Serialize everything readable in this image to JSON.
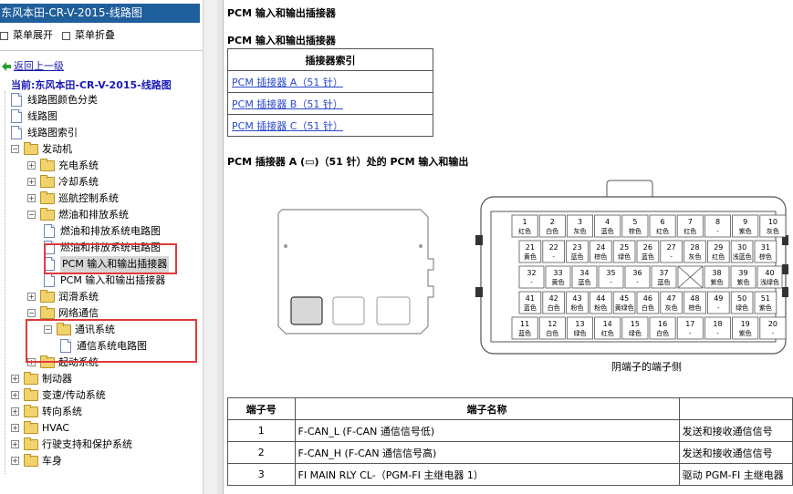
{
  "app": {
    "title": "东风本田-CR-V-2015-线路图"
  },
  "menu": {
    "expand": "菜单展开",
    "collapse": "菜单折叠"
  },
  "nav": {
    "back": "返回上一级",
    "current": "当前:东风本田-CR-V-2015-线路图"
  },
  "tree": [
    {
      "id": "color-class",
      "depth": 0,
      "type": "page",
      "label": "线路图颜色分类"
    },
    {
      "id": "wiring",
      "depth": 0,
      "type": "page",
      "label": "线路图"
    },
    {
      "id": "wiring-index",
      "depth": 0,
      "type": "page",
      "label": "线路图索引"
    },
    {
      "id": "engine",
      "depth": 0,
      "type": "folder",
      "toggle": "−",
      "label": "发动机"
    },
    {
      "id": "charging",
      "depth": 1,
      "type": "folder",
      "toggle": "+",
      "label": "充电系统"
    },
    {
      "id": "cooling",
      "depth": 1,
      "type": "folder",
      "toggle": "+",
      "label": "冷却系统"
    },
    {
      "id": "cruise",
      "depth": 1,
      "type": "folder",
      "toggle": "+",
      "label": "巡航控制系统"
    },
    {
      "id": "fuel",
      "depth": 1,
      "type": "folder",
      "toggle": "−",
      "label": "燃油和排放系统"
    },
    {
      "id": "fuel-circuit-1",
      "depth": 2,
      "type": "page",
      "label": "燃油和排放系统电路图"
    },
    {
      "id": "fuel-circuit-2",
      "depth": 2,
      "type": "page",
      "label": "燃油和排放系统电路图"
    },
    {
      "id": "pcm-io-selected",
      "depth": 2,
      "type": "page",
      "label": "PCM 输入和输出插接器",
      "selected": true
    },
    {
      "id": "pcm-io",
      "depth": 2,
      "type": "page",
      "label": "PCM 输入和输出插接器"
    },
    {
      "id": "lube",
      "depth": 1,
      "type": "folder",
      "toggle": "+",
      "label": "润滑系统"
    },
    {
      "id": "network",
      "depth": 1,
      "type": "folder",
      "toggle": "−",
      "label": "网络通信"
    },
    {
      "id": "comm",
      "depth": 2,
      "type": "folder",
      "toggle": "−",
      "label": "通讯系统"
    },
    {
      "id": "comm-circuit",
      "depth": 3,
      "type": "page",
      "label": "通信系统电路图"
    },
    {
      "id": "start",
      "depth": 1,
      "type": "folder",
      "toggle": "+",
      "label": "起动系统"
    },
    {
      "id": "brake",
      "depth": 0,
      "type": "folder",
      "toggle": "+",
      "label": "制动器"
    },
    {
      "id": "transmission",
      "depth": 0,
      "type": "folder",
      "toggle": "+",
      "label": "变速/传动系统"
    },
    {
      "id": "steering",
      "depth": 0,
      "type": "folder",
      "toggle": "+",
      "label": "转向系统"
    },
    {
      "id": "hvac",
      "depth": 0,
      "type": "folder",
      "toggle": "+",
      "label": "HVAC"
    },
    {
      "id": "driving-support",
      "depth": 0,
      "type": "folder",
      "toggle": "+",
      "label": "行驶支持和保护系统"
    },
    {
      "id": "body",
      "depth": 0,
      "type": "folder",
      "toggle": "+",
      "label": "车身"
    }
  ],
  "content": {
    "page_heading": "PCM 输入和输出插接器",
    "section_heading": "PCM 输入和输出插接器",
    "connector_index": {
      "header": "插接器索引",
      "links": [
        "PCM 插接器 A（51 针）",
        "PCM 插接器 B（51 针）",
        "PCM 插接器 C（51 针）"
      ]
    },
    "connector_a_heading": "PCM 插接器 A (▭)（51 针）处的 PCM 输入和输出",
    "diagram_caption": "阴端子的端子侧",
    "pin_rows": [
      [
        {
          "n": "1",
          "c": "红色"
        },
        {
          "n": "2",
          "c": "白色"
        },
        {
          "n": "3",
          "c": "灰色"
        },
        {
          "n": "4",
          "c": "蓝色"
        },
        {
          "n": "5",
          "c": "棕色"
        },
        {
          "n": "6",
          "c": "红色"
        },
        {
          "n": "7",
          "c": "红色"
        },
        {
          "n": "8",
          "c": "-"
        },
        {
          "n": "9",
          "c": "紫色"
        },
        {
          "n": "10",
          "c": "灰色"
        }
      ],
      [
        {
          "n": "21",
          "c": "黄色"
        },
        {
          "n": "22",
          "c": "-"
        },
        {
          "n": "23",
          "c": "蓝色"
        },
        {
          "n": "24",
          "c": "棕色"
        },
        {
          "n": "25",
          "c": "绿色"
        },
        {
          "n": "26",
          "c": "蓝色"
        },
        {
          "n": "27",
          "c": "-"
        },
        {
          "n": "28",
          "c": "灰色"
        },
        {
          "n": "29",
          "c": "红色"
        },
        {
          "n": "30",
          "c": "浅蓝色"
        },
        {
          "n": "31",
          "c": "棕色"
        }
      ],
      [
        {
          "n": "32",
          "c": "-"
        },
        {
          "n": "33",
          "c": "黄色"
        },
        {
          "n": "34",
          "c": "蓝色"
        },
        {
          "n": "35",
          "c": "-"
        },
        {
          "n": "36",
          "c": "-"
        },
        {
          "n": "37",
          "c": "蓝色"
        },
        {
          "n": "38",
          "c": "紫色"
        },
        {
          "n": "39",
          "c": "紫色"
        },
        {
          "n": "40",
          "c": "浅绿色"
        }
      ],
      [
        {
          "n": "41",
          "c": "蓝色"
        },
        {
          "n": "42",
          "c": "白色"
        },
        {
          "n": "43",
          "c": "粉色"
        },
        {
          "n": "44",
          "c": "粉色"
        },
        {
          "n": "45",
          "c": "黄绿色"
        },
        {
          "n": "46",
          "c": "白色"
        },
        {
          "n": "47",
          "c": "灰色"
        },
        {
          "n": "48",
          "c": "棕色"
        },
        {
          "n": "49",
          "c": "-"
        },
        {
          "n": "50",
          "c": "绿色"
        },
        {
          "n": "51",
          "c": "紫色"
        }
      ],
      [
        {
          "n": "11",
          "c": "蓝色"
        },
        {
          "n": "12",
          "c": "白色"
        },
        {
          "n": "13",
          "c": "绿色"
        },
        {
          "n": "14",
          "c": "红色"
        },
        {
          "n": "15",
          "c": "绿色"
        },
        {
          "n": "16",
          "c": "白色"
        },
        {
          "n": "17",
          "c": "-"
        },
        {
          "n": "18",
          "c": "-"
        },
        {
          "n": "19",
          "c": "紫色"
        },
        {
          "n": "20",
          "c": "-"
        }
      ]
    ],
    "pin_table": {
      "headers": [
        "端子号",
        "端子名称",
        ""
      ],
      "rows": [
        [
          "1",
          "F-CAN_L (F-CAN 通信信号低)",
          "发送和接收通信信号"
        ],
        [
          "2",
          "F-CAN_H (F-CAN 通信信号高)",
          "发送和接收通信信号"
        ],
        [
          "3",
          "FI MAIN RLY CL-（PGM-FI 主继电器 1）",
          "驱动 PGM-FI 主继电器"
        ]
      ]
    }
  }
}
